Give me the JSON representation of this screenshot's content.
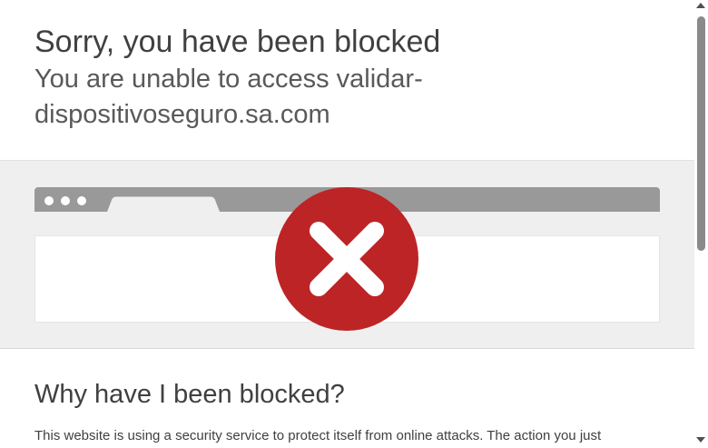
{
  "header": {
    "title": "Sorry, you have been blocked",
    "subtitle": "You are unable to access validar-dispositivoseguro.sa.com"
  },
  "illustration": {
    "icon": "blocked-x-icon",
    "icon_color": "#bd2426",
    "bar_color": "#999999"
  },
  "why_section": {
    "heading": "Why have I been blocked?",
    "body": "This website is using a security service to protect itself from online attacks. The action you just"
  },
  "colors": {
    "band_background": "#efefef",
    "text": "#404040"
  }
}
